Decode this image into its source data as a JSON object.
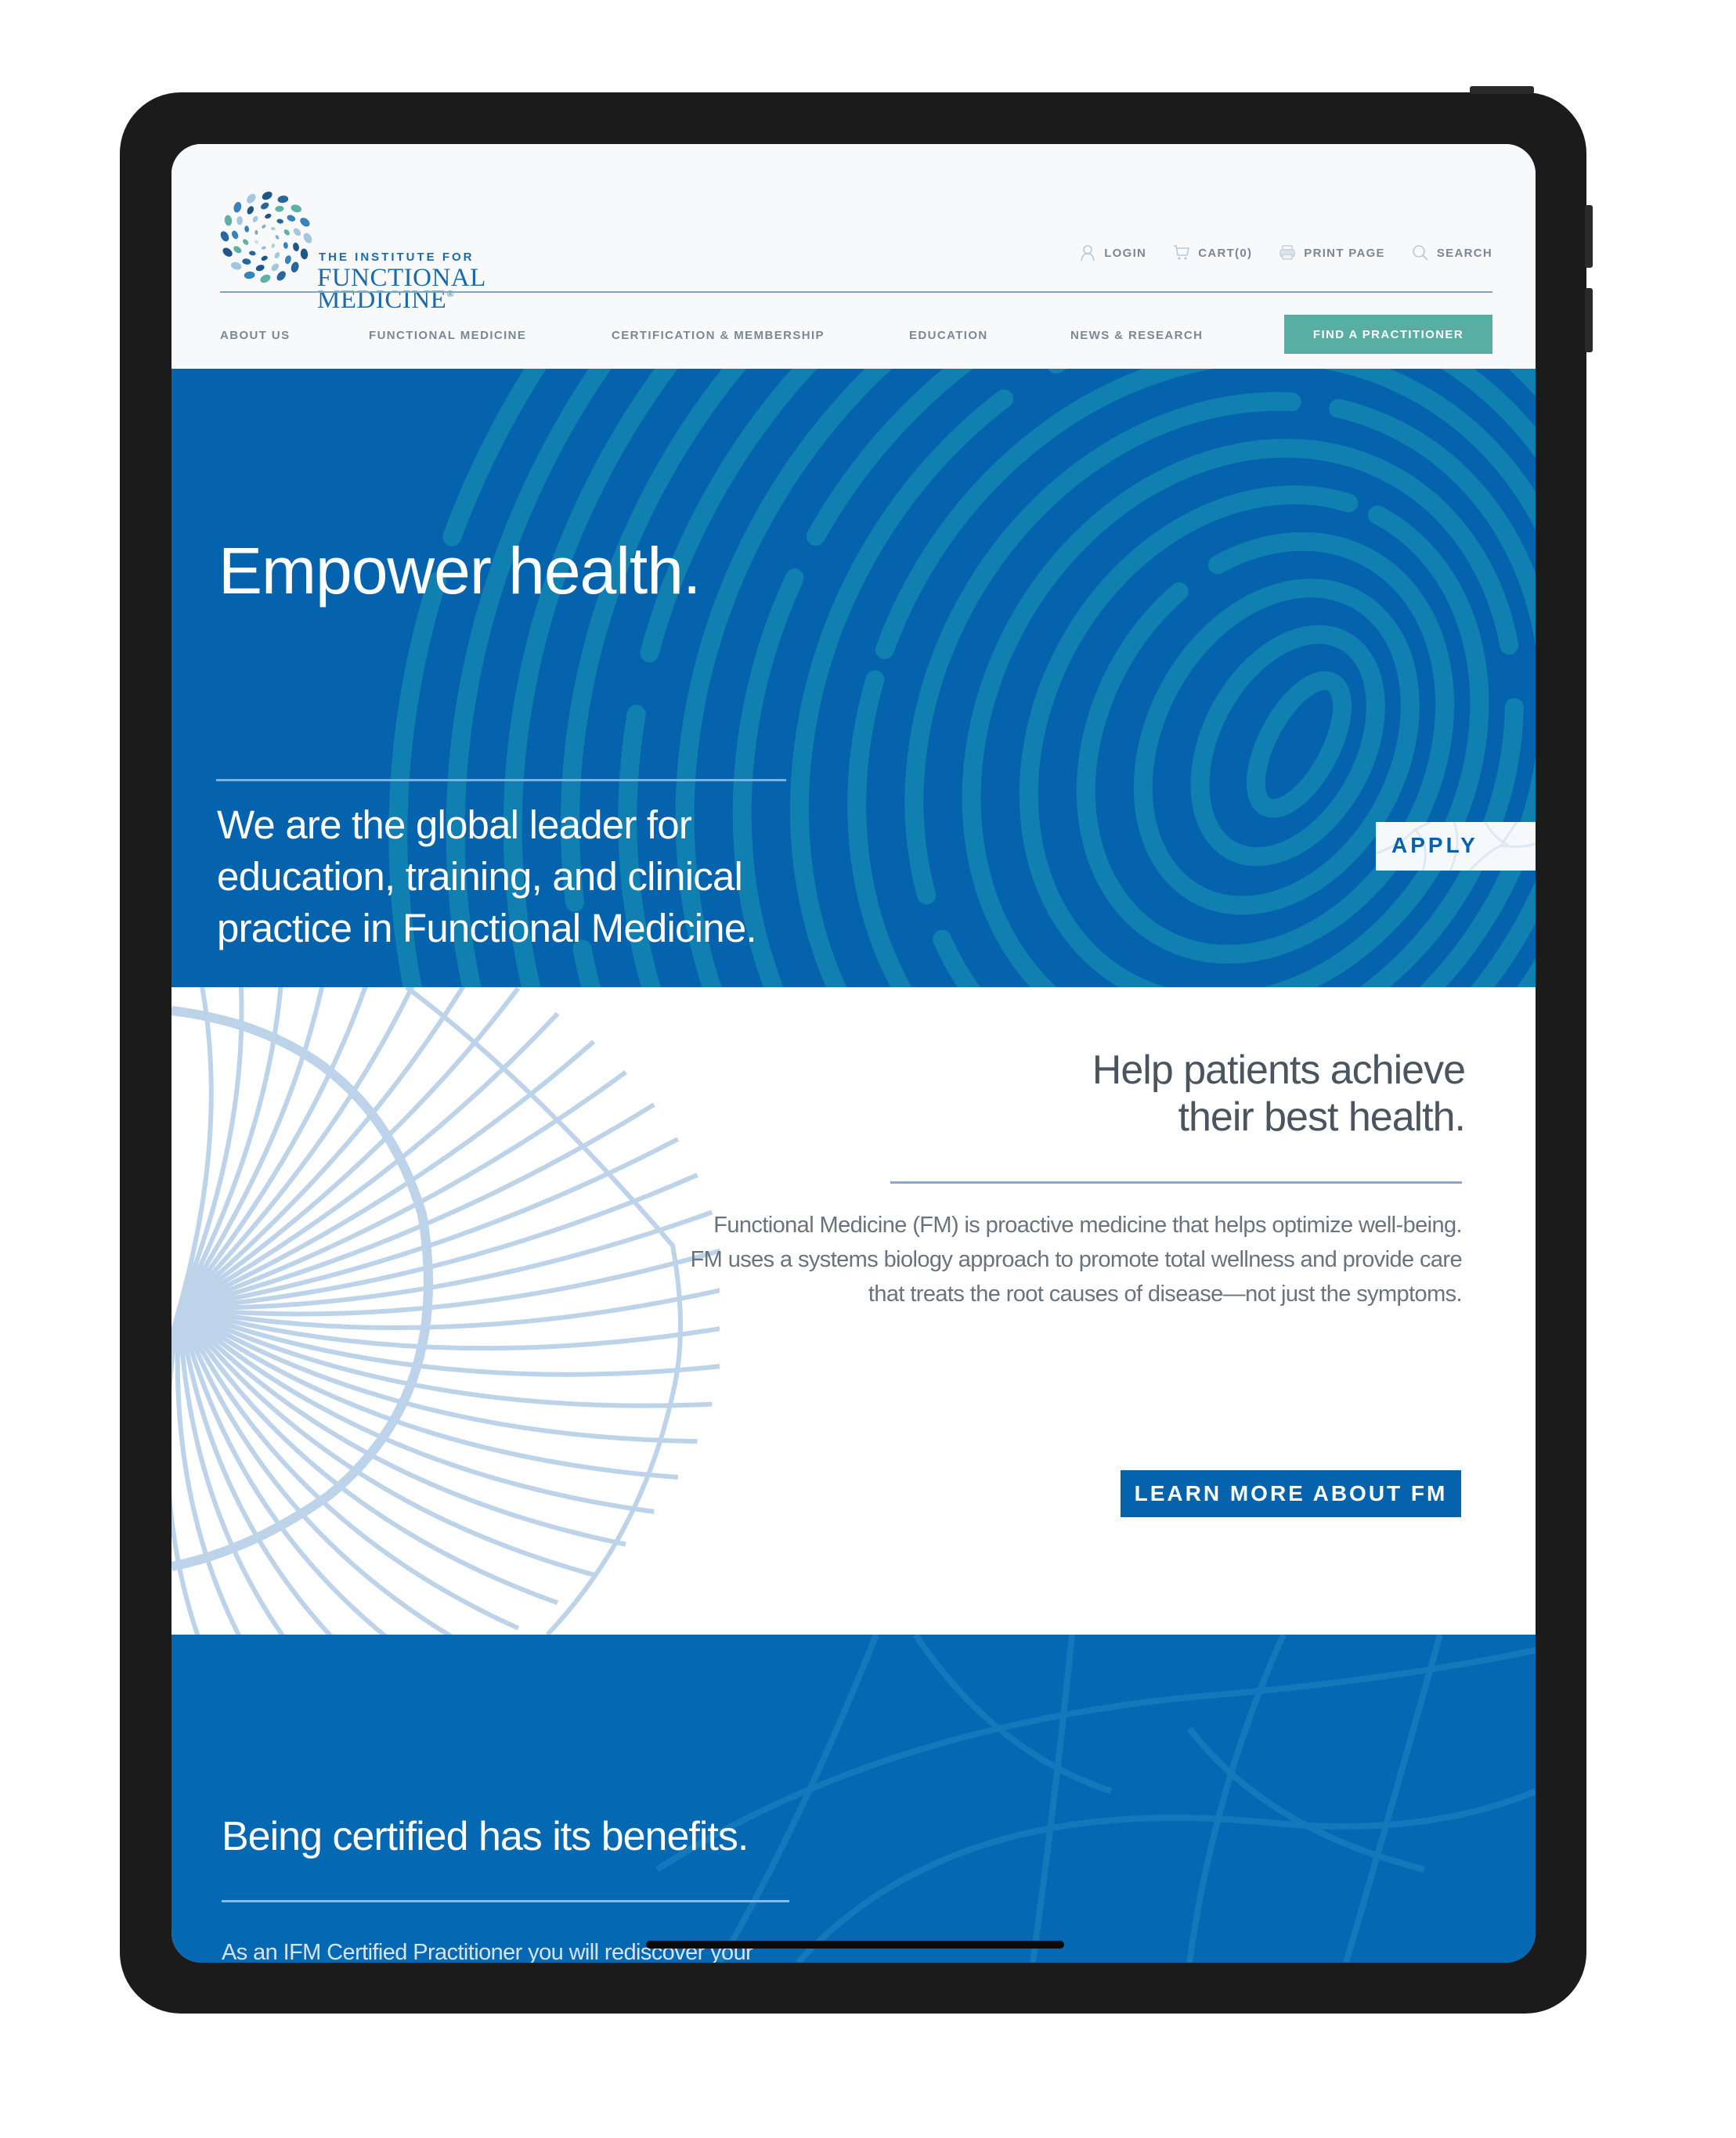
{
  "brand": {
    "line_small": "THE INSTITUTE FOR",
    "line1": "FUNCTIONAL",
    "line2": "MEDICINE",
    "registered": "®"
  },
  "utility_nav": [
    {
      "label": "LOGIN",
      "icon": "user-icon"
    },
    {
      "label": "CART(0)",
      "icon": "cart-icon"
    },
    {
      "label": "PRINT PAGE",
      "icon": "printer-icon"
    },
    {
      "label": "SEARCH",
      "icon": "search-icon"
    }
  ],
  "main_nav": [
    {
      "label": "ABOUT US"
    },
    {
      "label": "FUNCTIONAL MEDICINE"
    },
    {
      "label": "CERTIFICATION & MEMBERSHIP"
    },
    {
      "label": "EDUCATION"
    },
    {
      "label": "NEWS & RESEARCH"
    }
  ],
  "cta": {
    "label": "FIND A PRACTITIONER"
  },
  "hero": {
    "title": "Empower health.",
    "subtitle": "We are the global leader for education, training, and clinical practice in Functional Medicine.",
    "apply_label": "APPLY"
  },
  "about": {
    "title": "Help patients achieve\ntheir best health.",
    "body": "Functional Medicine (FM) is proactive medicine that helps optimize well-being. FM uses a systems biology approach to promote total wellness and provide care that treats the root causes of disease—not just the symptoms.",
    "button_label": "LEARN MORE ABOUT FM"
  },
  "certified": {
    "title": "Being certified has its benefits.",
    "body": "As an IFM Certified Practitioner you will rediscover your passion for care. Our world-leading education and training will advance your abilities to help patients reduce vulnerability,"
  },
  "colors": {
    "primary_blue": "#0563ae",
    "teal_cta": "#58aea3",
    "nav_text": "#7b8794",
    "pattern_light_blue": "#bcd3ea"
  }
}
